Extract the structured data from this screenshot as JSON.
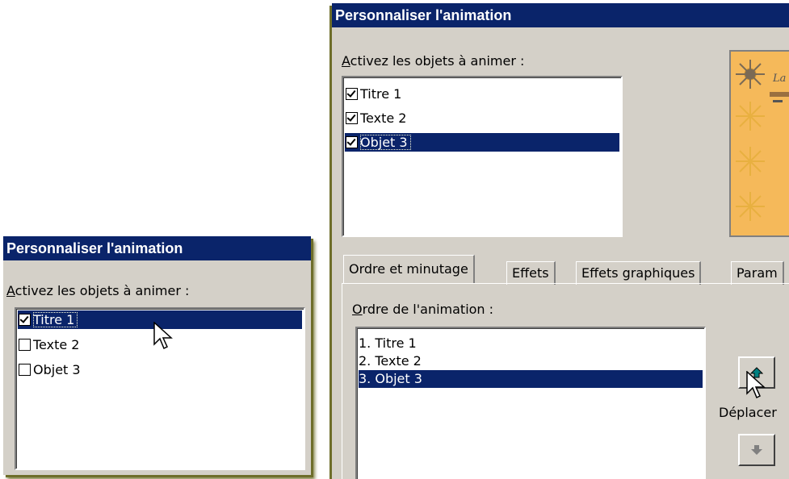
{
  "left_dialog": {
    "title": "Personnaliser l'animation",
    "objects_label_key": "A",
    "objects_label_rest": "ctivez les objets à animer :",
    "objects": [
      {
        "label": "Titre 1",
        "checked": true,
        "selected": true
      },
      {
        "label": "Texte 2",
        "checked": false,
        "selected": false
      },
      {
        "label": "Objet 3",
        "checked": false,
        "selected": false
      }
    ]
  },
  "right_dialog": {
    "title": "Personnaliser l'animation",
    "objects_label_key": "A",
    "objects_label_rest": "ctivez les objets à animer :",
    "objects": [
      {
        "label": "Titre 1",
        "checked": true,
        "selected": false
      },
      {
        "label": "Texte 2",
        "checked": true,
        "selected": false
      },
      {
        "label": "Objet 3",
        "checked": true,
        "selected": true
      }
    ],
    "preview_text": "La",
    "tabs": [
      "Ordre et minutage",
      "Effets",
      "Effets graphiques",
      "Param"
    ],
    "order_label_key": "O",
    "order_label_rest": "rdre de l'animation :",
    "order_items": [
      "1. Titre 1",
      "2. Texte 2",
      "3. Objet 3"
    ],
    "order_selected_index": 2,
    "move_label": "Déplacer",
    "move_up_icon": "arrow-up-icon",
    "move_down_icon": "arrow-down-icon"
  },
  "colors": {
    "titlebar": "#0a246a",
    "selection": "#0a246a",
    "face": "#d4d0c8",
    "preview_bg": "#f5b95a",
    "arrow_active": "#008080"
  }
}
